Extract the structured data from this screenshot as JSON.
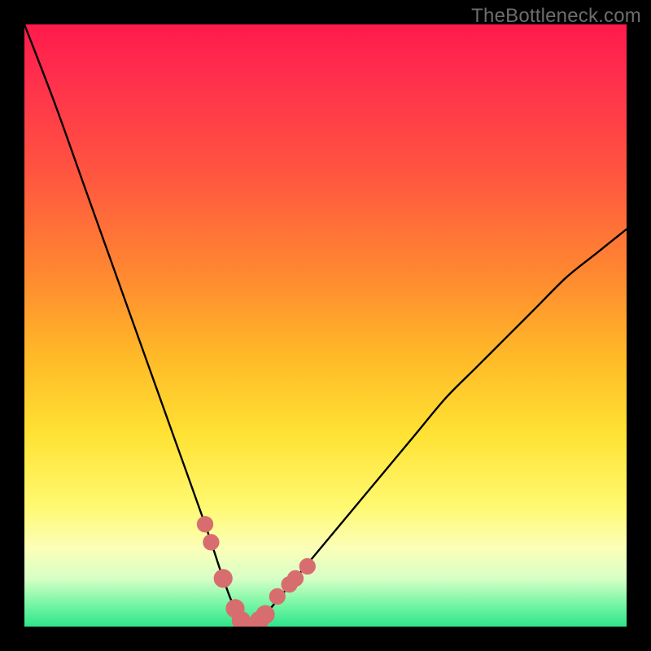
{
  "watermark": "TheBottleneck.com",
  "colors": {
    "frame": "#000000",
    "curve": "#000000",
    "marker_fill": "#d86d6f",
    "marker_stroke": "#d86d6f"
  },
  "chart_data": {
    "type": "line",
    "title": "",
    "xlabel": "",
    "ylabel": "",
    "xlim": [
      0,
      100
    ],
    "ylim": [
      0,
      100
    ],
    "grid": false,
    "legend": false,
    "series": [
      {
        "name": "bottleneck-curve",
        "x": [
          0,
          5,
          10,
          15,
          20,
          25,
          30,
          33,
          35,
          37,
          38,
          40,
          45,
          50,
          55,
          60,
          65,
          70,
          75,
          80,
          85,
          90,
          95,
          100
        ],
        "y": [
          100,
          87,
          73,
          59,
          45,
          31,
          17,
          8,
          3,
          1,
          0,
          2,
          8,
          14,
          20,
          26,
          32,
          38,
          43,
          48,
          53,
          58,
          62,
          66
        ]
      }
    ],
    "markers": [
      {
        "x": 30,
        "y": 17,
        "r": 1.3
      },
      {
        "x": 31,
        "y": 14,
        "r": 1.3
      },
      {
        "x": 33,
        "y": 8,
        "r": 1.5,
        "type": "chain"
      },
      {
        "x": 35,
        "y": 3,
        "r": 1.5,
        "type": "chain"
      },
      {
        "x": 36,
        "y": 1,
        "r": 1.5,
        "type": "chain"
      },
      {
        "x": 37,
        "y": 0,
        "r": 1.5,
        "type": "chain"
      },
      {
        "x": 38,
        "y": 0,
        "r": 1.5,
        "type": "chain"
      },
      {
        "x": 39,
        "y": 1,
        "r": 1.5,
        "type": "chain"
      },
      {
        "x": 40,
        "y": 2,
        "r": 1.5,
        "type": "chain"
      },
      {
        "x": 42,
        "y": 5,
        "r": 1.3
      },
      {
        "x": 44,
        "y": 7,
        "r": 1.3
      },
      {
        "x": 45,
        "y": 8,
        "r": 1.3
      },
      {
        "x": 47,
        "y": 10,
        "r": 1.3
      }
    ]
  }
}
